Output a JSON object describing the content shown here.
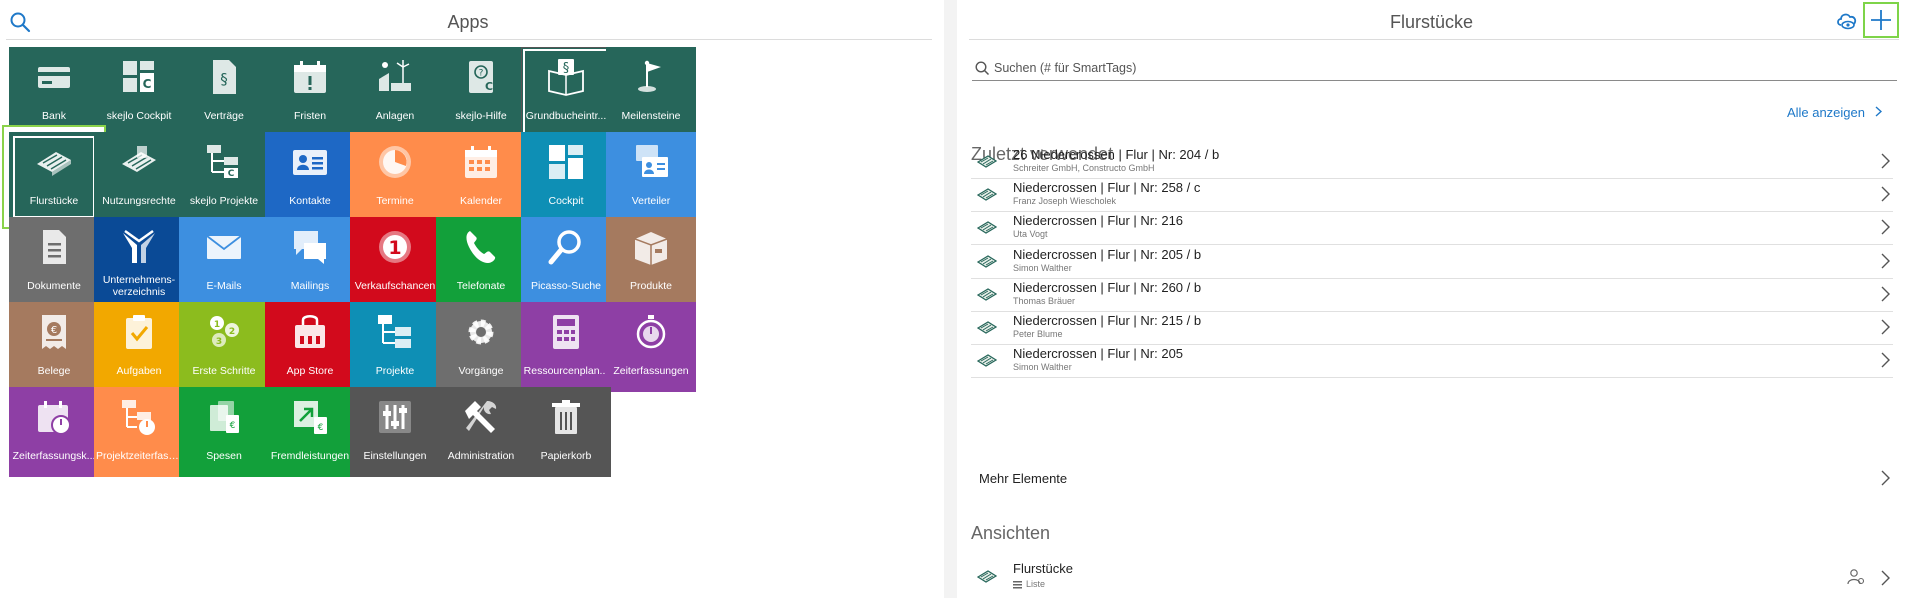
{
  "apps_panel": {
    "title": "Apps"
  },
  "tiles": [
    {
      "label": "Bank",
      "color": "#26665a",
      "icon": "card-icon"
    },
    {
      "label": "skejlo Cockpit",
      "color": "#26665a",
      "icon": "cockpit-icon"
    },
    {
      "label": "Verträge",
      "color": "#26665a",
      "icon": "contract-icon"
    },
    {
      "label": "Fristen",
      "color": "#26665a",
      "icon": "calendar-alert-icon"
    },
    {
      "label": "Anlagen",
      "color": "#26665a",
      "icon": "plant-icon"
    },
    {
      "label": "skejlo-Hilfe",
      "color": "#26665a",
      "icon": "help-icon"
    },
    {
      "label": "Grundbucheintr...",
      "color": "#26665a",
      "icon": "law-book-icon",
      "selected": "white"
    },
    {
      "label": "Meilensteine",
      "color": "#26665a",
      "icon": "milestone-flag-icon"
    },
    {
      "label": "Flurstücke",
      "color": "#26665a",
      "icon": "land-parcel-icon",
      "selected": "green"
    },
    {
      "label": "Nutzungsrechte",
      "color": "#26665a",
      "icon": "usage-rights-icon"
    },
    {
      "label": "skejlo Projekte",
      "color": "#26665a",
      "icon": "project-tree-icon"
    },
    {
      "label": "Kontakte",
      "color": "#1e68c5",
      "icon": "contact-card-icon"
    },
    {
      "label": "Termine",
      "color": "#ff8c4b",
      "icon": "appointment-icon"
    },
    {
      "label": "Kalender",
      "color": "#ff8c4b",
      "icon": "calendar-icon"
    },
    {
      "label": "Cockpit",
      "color": "#0e8fb5",
      "icon": "dashboard-icon"
    },
    {
      "label": "Verteiler",
      "color": "#3d8fe0",
      "icon": "distribution-icon"
    },
    {
      "label": "Dokumente",
      "color": "#6e6e6e",
      "icon": "document-icon"
    },
    {
      "label": "Unternehmens-verzeichnis",
      "color": "#0a4a96",
      "icon": "company-directory-icon",
      "two_line": true
    },
    {
      "label": "E-Mails",
      "color": "#3d8fe0",
      "icon": "mail-icon"
    },
    {
      "label": "Mailings",
      "color": "#3d8fe0",
      "icon": "mailing-icon"
    },
    {
      "label": "Verkaufschancen",
      "color": "#d20a1c",
      "icon": "sales-opportunity-icon"
    },
    {
      "label": "Telefonate",
      "color": "#12a03a",
      "icon": "phone-icon"
    },
    {
      "label": "Picasso-Suche",
      "color": "#3d8fe0",
      "icon": "magnifier-icon"
    },
    {
      "label": "Produkte",
      "color": "#a57a5f",
      "icon": "product-box-icon"
    },
    {
      "label": "Belege",
      "color": "#a57a5f",
      "icon": "receipt-icon"
    },
    {
      "label": "Aufgaben",
      "color": "#f2a800",
      "icon": "task-clipboard-icon"
    },
    {
      "label": "Erste Schritte",
      "color": "#8cbc1e",
      "icon": "first-steps-icon"
    },
    {
      "label": "App Store",
      "color": "#d20a1c",
      "icon": "shopping-bag-icon"
    },
    {
      "label": "Projekte",
      "color": "#0e8fb5",
      "icon": "projects-icon"
    },
    {
      "label": "Vorgänge",
      "color": "#6e6e6e",
      "icon": "gear-icon"
    },
    {
      "label": "Ressourcenplan...",
      "color": "#8e3fa5",
      "icon": "resource-calculator-icon"
    },
    {
      "label": "Zeiterfassungen",
      "color": "#8e3fa5",
      "icon": "stopwatch-icon"
    },
    {
      "label": "Zeiterfassungsk...",
      "color": "#8e3fa5",
      "icon": "time-calendar-icon"
    },
    {
      "label": "Projektzeiterfass...",
      "color": "#ff8c4b",
      "icon": "project-time-icon"
    },
    {
      "label": "Spesen",
      "color": "#12a03a",
      "icon": "expenses-icon"
    },
    {
      "label": "Fremdleistungen",
      "color": "#12a03a",
      "icon": "external-services-icon"
    },
    {
      "label": "Einstellungen",
      "color": "#555555",
      "icon": "settings-sliders-icon"
    },
    {
      "label": "Administration",
      "color": "#555555",
      "icon": "tools-icon"
    },
    {
      "label": "Papierkorb",
      "color": "#555555",
      "icon": "trash-icon"
    }
  ],
  "right_panel": {
    "title": "Flurstücke",
    "search_placeholder": "Suchen (# für SmartTags)",
    "show_all": "Alle anzeigen",
    "recent_title": "Zuletzt verwendet",
    "recent": [
      {
        "title": "26 Niedercrossen | Flur | Nr: 204 / b",
        "sub": "Schreiter GmbH, Constructo GmbH"
      },
      {
        "title": "Niedercrossen | Flur | Nr: 258 / c",
        "sub": "Franz Joseph Wiescholek"
      },
      {
        "title": "Niedercrossen | Flur | Nr: 216",
        "sub": "Uta Vogt"
      },
      {
        "title": "Niedercrossen | Flur | Nr: 205 / b",
        "sub": "Simon Walther"
      },
      {
        "title": "Niedercrossen | Flur | Nr: 260 / b",
        "sub": "Thomas Bräuer"
      },
      {
        "title": "Niedercrossen | Flur | Nr: 215 / b",
        "sub": "Peter Blume"
      },
      {
        "title": "Niedercrossen | Flur | Nr: 205",
        "sub": "Simon Walther"
      }
    ],
    "more": "Mehr Elemente",
    "views_title": "Ansichten",
    "view": {
      "title": "Flurstücke",
      "sub": "Liste"
    }
  }
}
